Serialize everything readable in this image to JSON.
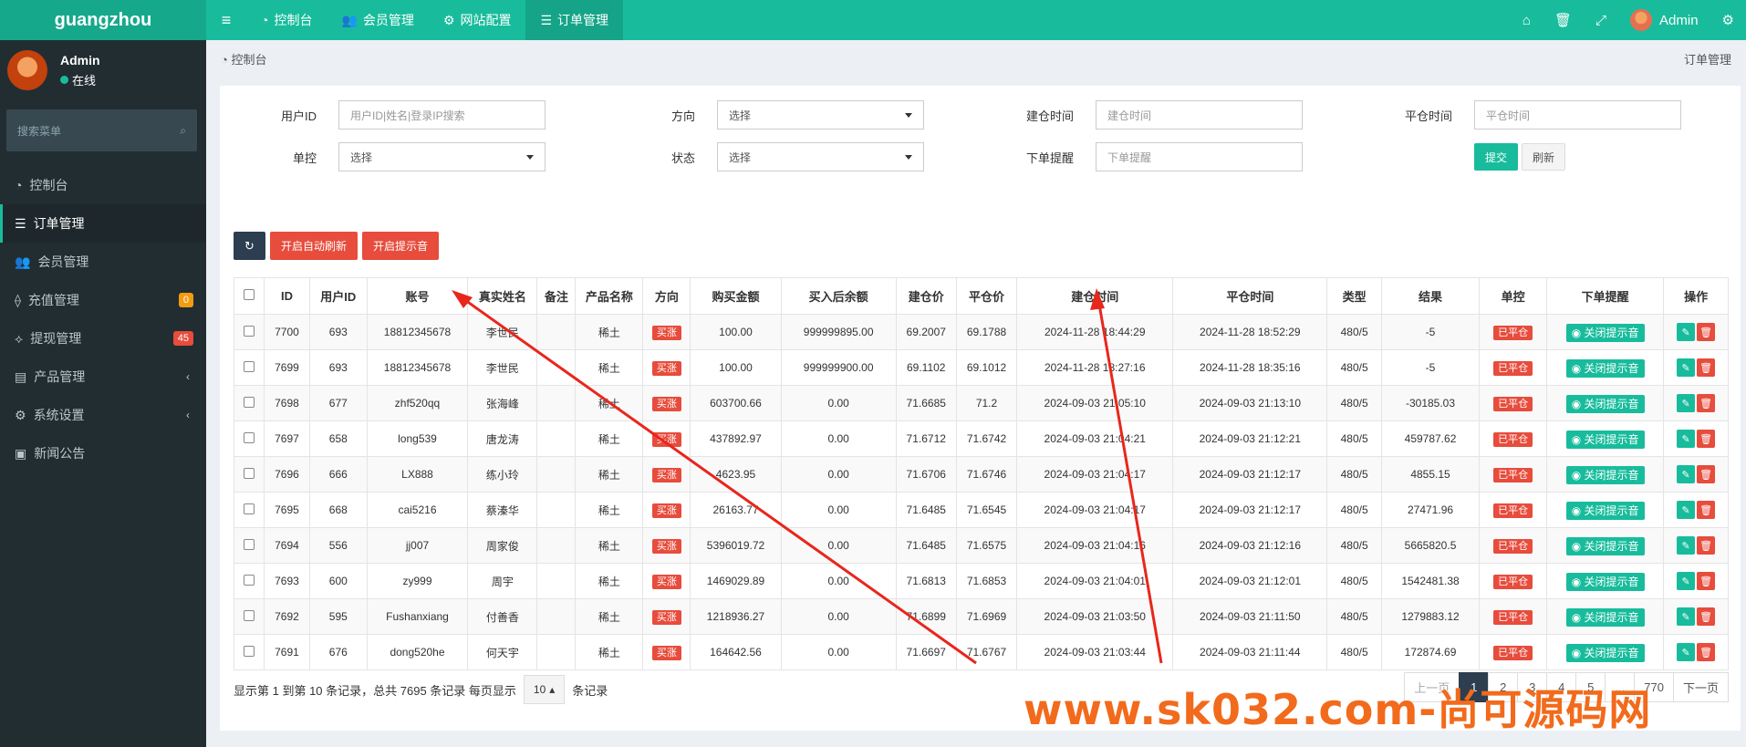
{
  "app": {
    "logo": "guangzhou"
  },
  "topnav": {
    "items": [
      {
        "icon": "dashboard-icon",
        "label": "控制台"
      },
      {
        "icon": "users-icon",
        "label": "会员管理"
      },
      {
        "icon": "gear-icon",
        "label": "网站配置"
      },
      {
        "icon": "list-icon",
        "label": "订单管理"
      }
    ],
    "user": "Admin"
  },
  "sidebar": {
    "user": {
      "name": "Admin",
      "status": "在线"
    },
    "search_placeholder": "搜索菜单",
    "items": [
      {
        "icon": "dashboard-icon",
        "label": "控制台"
      },
      {
        "icon": "list-icon",
        "label": "订单管理"
      },
      {
        "icon": "users-icon",
        "label": "会员管理"
      },
      {
        "icon": "recharge-icon",
        "label": "充值管理",
        "badge": "0",
        "badge_color": "#f39c12"
      },
      {
        "icon": "withdraw-icon",
        "label": "提现管理",
        "badge": "45",
        "badge_color": "#e74c3c"
      },
      {
        "icon": "product-icon",
        "label": "产品管理"
      },
      {
        "icon": "settings-icon",
        "label": "系统设置"
      },
      {
        "icon": "news-icon",
        "label": "新闻公告"
      }
    ]
  },
  "breadcrumb": {
    "left": "控制台",
    "right": "订单管理"
  },
  "filters": {
    "user_id": {
      "label": "用户ID",
      "placeholder": "用户ID|姓名|登录IP搜索"
    },
    "direction": {
      "label": "方向",
      "value": "选择"
    },
    "open_time": {
      "label": "建仓时间",
      "placeholder": "建仓时间"
    },
    "close_time": {
      "label": "平仓时间",
      "placeholder": "平仓时间"
    },
    "control": {
      "label": "单控",
      "value": "选择"
    },
    "status": {
      "label": "状态",
      "value": "选择"
    },
    "order_alert": {
      "label": "下单提醒",
      "placeholder": "下单提醒"
    },
    "submit": "提交",
    "refresh": "刷新"
  },
  "toolbar": {
    "auto_refresh": "开启自动刷新",
    "sound": "开启提示音"
  },
  "table": {
    "headers": [
      "ID",
      "用户ID",
      "账号",
      "真实姓名",
      "备注",
      "产品名称",
      "方向",
      "购买金额",
      "买入后余额",
      "建仓价",
      "平仓价",
      "建仓时间",
      "平仓时间",
      "类型",
      "结果",
      "单控",
      "下单提醒",
      "操作"
    ],
    "rows": [
      [
        "7700",
        "693",
        "18812345678",
        "李世民",
        "",
        "稀土",
        "买涨",
        "100.00",
        "999999895.00",
        "69.2007",
        "69.1788",
        "2024-11-28 18:44:29",
        "2024-11-28 18:52:29",
        "480/5",
        "-5",
        "已平仓",
        "关闭提示音"
      ],
      [
        "7699",
        "693",
        "18812345678",
        "李世民",
        "",
        "稀土",
        "买涨",
        "100.00",
        "999999900.00",
        "69.1102",
        "69.1012",
        "2024-11-28 18:27:16",
        "2024-11-28 18:35:16",
        "480/5",
        "-5",
        "已平仓",
        "关闭提示音"
      ],
      [
        "7698",
        "677",
        "zhf520qq",
        "张海峰",
        "",
        "稀土",
        "买涨",
        "603700.66",
        "0.00",
        "71.6685",
        "71.2",
        "2024-09-03 21:05:10",
        "2024-09-03 21:13:10",
        "480/5",
        "-30185.03",
        "已平仓",
        "关闭提示音"
      ],
      [
        "7697",
        "658",
        "long539",
        "唐龙涛",
        "",
        "稀土",
        "买涨",
        "437892.97",
        "0.00",
        "71.6712",
        "71.6742",
        "2024-09-03 21:04:21",
        "2024-09-03 21:12:21",
        "480/5",
        "459787.62",
        "已平仓",
        "关闭提示音"
      ],
      [
        "7696",
        "666",
        "LX888",
        "练小玲",
        "",
        "稀土",
        "买涨",
        "4623.95",
        "0.00",
        "71.6706",
        "71.6746",
        "2024-09-03 21:04:17",
        "2024-09-03 21:12:17",
        "480/5",
        "4855.15",
        "已平仓",
        "关闭提示音"
      ],
      [
        "7695",
        "668",
        "cai5216",
        "蔡溱华",
        "",
        "稀土",
        "买涨",
        "26163.77",
        "0.00",
        "71.6485",
        "71.6545",
        "2024-09-03 21:04:17",
        "2024-09-03 21:12:17",
        "480/5",
        "27471.96",
        "已平仓",
        "关闭提示音"
      ],
      [
        "7694",
        "556",
        "jj007",
        "周家俊",
        "",
        "稀土",
        "买涨",
        "5396019.72",
        "0.00",
        "71.6485",
        "71.6575",
        "2024-09-03 21:04:16",
        "2024-09-03 21:12:16",
        "480/5",
        "5665820.5",
        "已平仓",
        "关闭提示音"
      ],
      [
        "7693",
        "600",
        "zy999",
        "周宇",
        "",
        "稀土",
        "买涨",
        "1469029.89",
        "0.00",
        "71.6813",
        "71.6853",
        "2024-09-03 21:04:01",
        "2024-09-03 21:12:01",
        "480/5",
        "1542481.38",
        "已平仓",
        "关闭提示音"
      ],
      [
        "7692",
        "595",
        "Fushanxiang",
        "付善香",
        "",
        "稀土",
        "买涨",
        "1218936.27",
        "0.00",
        "71.6899",
        "71.6969",
        "2024-09-03 21:03:50",
        "2024-09-03 21:11:50",
        "480/5",
        "1279883.12",
        "已平仓",
        "关闭提示音"
      ],
      [
        "7691",
        "676",
        "dong520he",
        "何天宇",
        "",
        "稀土",
        "买涨",
        "164642.56",
        "0.00",
        "71.6697",
        "71.6767",
        "2024-09-03 21:03:44",
        "2024-09-03 21:11:44",
        "480/5",
        "172874.69",
        "已平仓",
        "关闭提示音"
      ]
    ]
  },
  "footer": {
    "summary": "显示第 1 到第 10 条记录，总共 7695 条记录 每页显示",
    "page_size": "10",
    "suffix": "条记录"
  },
  "pager": {
    "prev": "上一页",
    "pages": [
      "1",
      "2",
      "3",
      "4",
      "5",
      "...",
      "770"
    ],
    "current": "1",
    "next": "下一页"
  },
  "watermark": "www.sk032.com-尚可源码网",
  "colors": {
    "primary": "#18bc9c",
    "danger": "#e74c3c",
    "dark": "#2c3e50",
    "sidebar": "#222d32"
  }
}
